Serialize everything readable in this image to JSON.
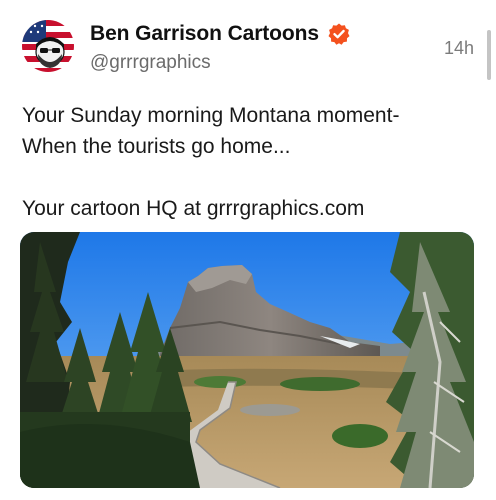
{
  "post": {
    "author_name": "Ben Garrison Cartoons",
    "handle": "@grrrgraphics",
    "timestamp": "14h",
    "text_lines": [
      "Your Sunday morning Montana moment-",
      "When the tourists go home...",
      "Your cartoon HQ at grrrgraphics.com"
    ],
    "verified_icon": "verified-badge-icon",
    "colors": {
      "verified": "#f4511e",
      "handle": "#6b6b6b",
      "timestamp": "#7b7b7b"
    }
  }
}
